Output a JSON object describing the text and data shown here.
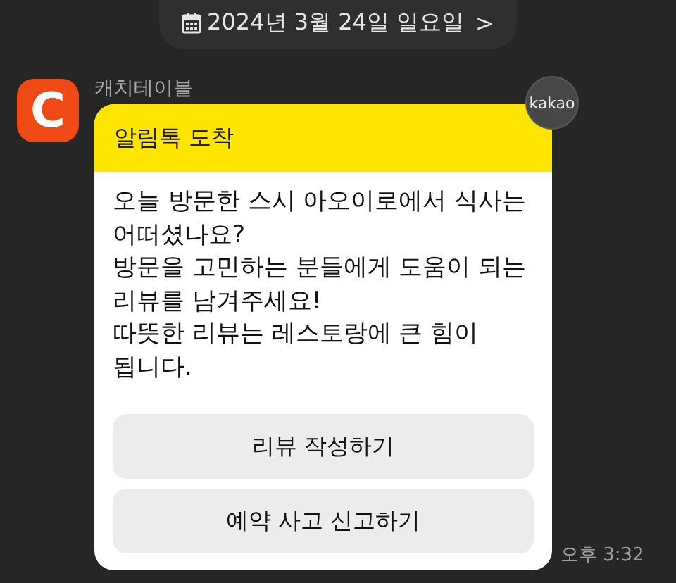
{
  "date_divider": {
    "label": "2024년 3월 24일 일요일",
    "chevron": ">"
  },
  "message": {
    "sender": "캐치테이블",
    "avatar_letter": "C",
    "badge": "kakao",
    "header": "알림톡 도착",
    "body": "오늘 방문한 스시 아오이로에서 식사는 어떠셨나요?\n방문을 고민하는 분들에게 도움이 되는 리뷰를 남겨주세요!\n따뜻한 리뷰는 레스토랑에 큰 힘이 됩니다.",
    "buttons": [
      "리뷰 작성하기",
      "예약 사고 신고하기"
    ],
    "time": "오후 3:32"
  }
}
